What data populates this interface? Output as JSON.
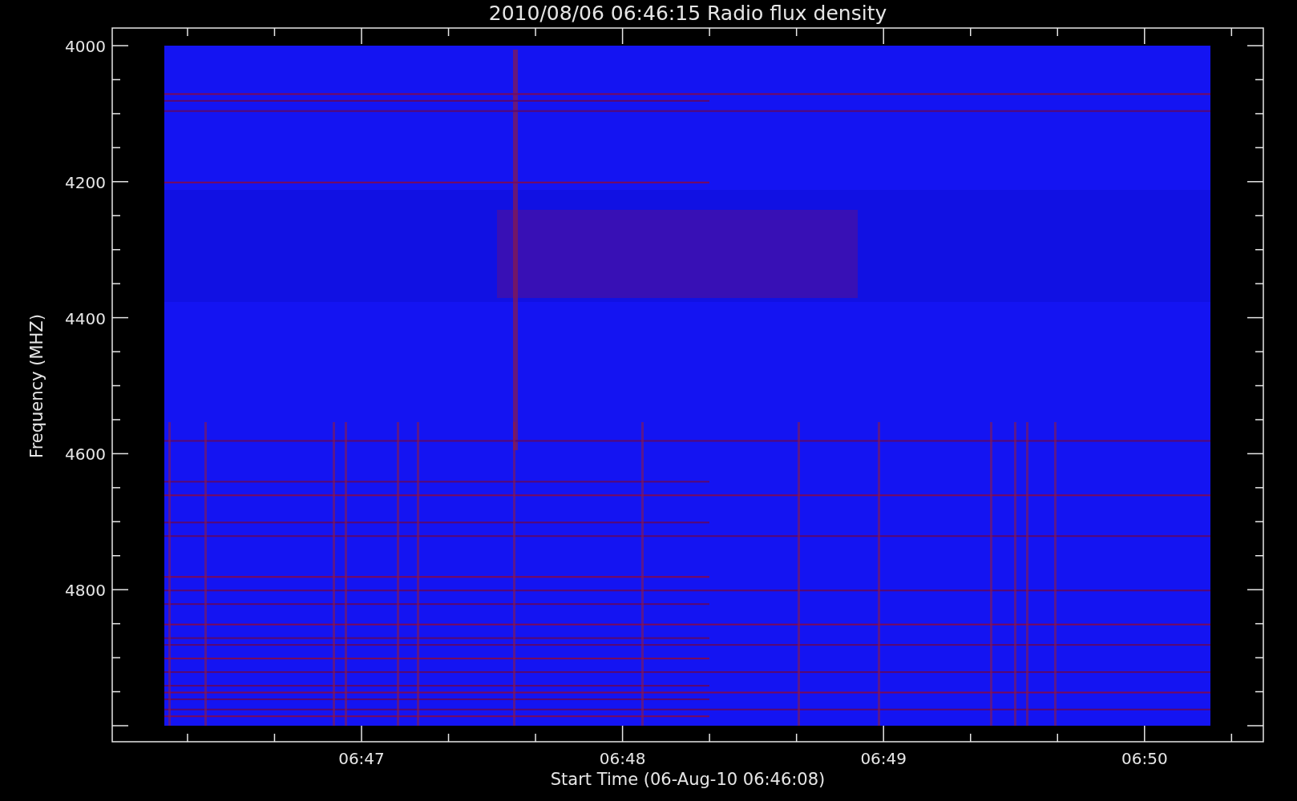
{
  "plot": {
    "title": "2010/08/06 06:46:15 Radio flux density",
    "ylabel": "Frequency (MHZ)",
    "xlabel": "Start Time (06-Aug-10 06:46:08)",
    "yticks": [
      "4000",
      "4200",
      "4400",
      "4600",
      "4800"
    ],
    "xticks": [
      "06:47",
      "06:48",
      "06:49",
      "06:50"
    ]
  }
}
